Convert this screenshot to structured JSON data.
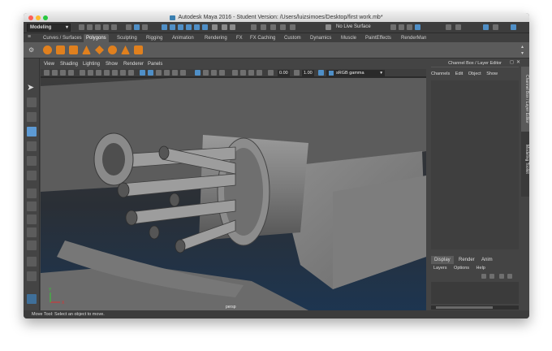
{
  "window": {
    "title": "Autodesk Maya 2016 - Student Version: /Users/luizsimoes/Desktop/first work.mb*"
  },
  "status_line": {
    "mode": "Modeling",
    "live_surface": "No Live Surface"
  },
  "shelf_tabs": [
    "Curves / Surfaces",
    "Polygons",
    "Sculpting",
    "Rigging",
    "Animation",
    "Rendering",
    "FX",
    "FX Caching",
    "Custom",
    "Dynamics",
    "Muscle",
    "PaintEffects",
    "RenderMan"
  ],
  "shelf_active_tab": "Polygons",
  "viewport": {
    "menus": [
      "View",
      "Shading",
      "Lighting",
      "Show",
      "Renderer",
      "Panels"
    ],
    "exposure": "0.00",
    "gamma": "1.00",
    "color_space": "sRGB gamma",
    "camera": "persp",
    "axis_x": "X",
    "axis_y": "Y"
  },
  "channel_box": {
    "header": "Channel Box / Layer Editor",
    "menus": [
      "Channels",
      "Edit",
      "Object",
      "Show"
    ],
    "side_tabs": [
      "Channel Box / Layer Editor",
      "Modeling Toolkit"
    ]
  },
  "layer_editor": {
    "tabs": [
      "Display",
      "Render",
      "Anim"
    ],
    "menus": [
      "Layers",
      "Options",
      "Help"
    ]
  },
  "help_line": "Move Tool: Select an object to move.",
  "colors": {
    "accent": "#5d9ad4",
    "polygon_shelf_icon": "#e0801e",
    "viewport_bg_top": "#3a3a3a",
    "viewport_bg_bottom": "#1f3a55"
  }
}
